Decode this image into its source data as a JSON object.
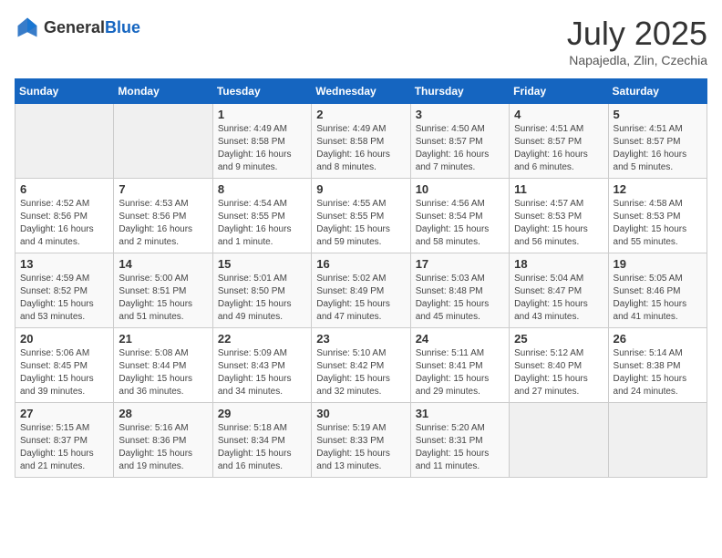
{
  "header": {
    "logo_general": "General",
    "logo_blue": "Blue",
    "month": "July 2025",
    "location": "Napajedla, Zlin, Czechia"
  },
  "days_of_week": [
    "Sunday",
    "Monday",
    "Tuesday",
    "Wednesday",
    "Thursday",
    "Friday",
    "Saturday"
  ],
  "weeks": [
    [
      {
        "day": "",
        "info": ""
      },
      {
        "day": "",
        "info": ""
      },
      {
        "day": "1",
        "info": "Sunrise: 4:49 AM\nSunset: 8:58 PM\nDaylight: 16 hours and 9 minutes."
      },
      {
        "day": "2",
        "info": "Sunrise: 4:49 AM\nSunset: 8:58 PM\nDaylight: 16 hours and 8 minutes."
      },
      {
        "day": "3",
        "info": "Sunrise: 4:50 AM\nSunset: 8:57 PM\nDaylight: 16 hours and 7 minutes."
      },
      {
        "day": "4",
        "info": "Sunrise: 4:51 AM\nSunset: 8:57 PM\nDaylight: 16 hours and 6 minutes."
      },
      {
        "day": "5",
        "info": "Sunrise: 4:51 AM\nSunset: 8:57 PM\nDaylight: 16 hours and 5 minutes."
      }
    ],
    [
      {
        "day": "6",
        "info": "Sunrise: 4:52 AM\nSunset: 8:56 PM\nDaylight: 16 hours and 4 minutes."
      },
      {
        "day": "7",
        "info": "Sunrise: 4:53 AM\nSunset: 8:56 PM\nDaylight: 16 hours and 2 minutes."
      },
      {
        "day": "8",
        "info": "Sunrise: 4:54 AM\nSunset: 8:55 PM\nDaylight: 16 hours and 1 minute."
      },
      {
        "day": "9",
        "info": "Sunrise: 4:55 AM\nSunset: 8:55 PM\nDaylight: 15 hours and 59 minutes."
      },
      {
        "day": "10",
        "info": "Sunrise: 4:56 AM\nSunset: 8:54 PM\nDaylight: 15 hours and 58 minutes."
      },
      {
        "day": "11",
        "info": "Sunrise: 4:57 AM\nSunset: 8:53 PM\nDaylight: 15 hours and 56 minutes."
      },
      {
        "day": "12",
        "info": "Sunrise: 4:58 AM\nSunset: 8:53 PM\nDaylight: 15 hours and 55 minutes."
      }
    ],
    [
      {
        "day": "13",
        "info": "Sunrise: 4:59 AM\nSunset: 8:52 PM\nDaylight: 15 hours and 53 minutes."
      },
      {
        "day": "14",
        "info": "Sunrise: 5:00 AM\nSunset: 8:51 PM\nDaylight: 15 hours and 51 minutes."
      },
      {
        "day": "15",
        "info": "Sunrise: 5:01 AM\nSunset: 8:50 PM\nDaylight: 15 hours and 49 minutes."
      },
      {
        "day": "16",
        "info": "Sunrise: 5:02 AM\nSunset: 8:49 PM\nDaylight: 15 hours and 47 minutes."
      },
      {
        "day": "17",
        "info": "Sunrise: 5:03 AM\nSunset: 8:48 PM\nDaylight: 15 hours and 45 minutes."
      },
      {
        "day": "18",
        "info": "Sunrise: 5:04 AM\nSunset: 8:47 PM\nDaylight: 15 hours and 43 minutes."
      },
      {
        "day": "19",
        "info": "Sunrise: 5:05 AM\nSunset: 8:46 PM\nDaylight: 15 hours and 41 minutes."
      }
    ],
    [
      {
        "day": "20",
        "info": "Sunrise: 5:06 AM\nSunset: 8:45 PM\nDaylight: 15 hours and 39 minutes."
      },
      {
        "day": "21",
        "info": "Sunrise: 5:08 AM\nSunset: 8:44 PM\nDaylight: 15 hours and 36 minutes."
      },
      {
        "day": "22",
        "info": "Sunrise: 5:09 AM\nSunset: 8:43 PM\nDaylight: 15 hours and 34 minutes."
      },
      {
        "day": "23",
        "info": "Sunrise: 5:10 AM\nSunset: 8:42 PM\nDaylight: 15 hours and 32 minutes."
      },
      {
        "day": "24",
        "info": "Sunrise: 5:11 AM\nSunset: 8:41 PM\nDaylight: 15 hours and 29 minutes."
      },
      {
        "day": "25",
        "info": "Sunrise: 5:12 AM\nSunset: 8:40 PM\nDaylight: 15 hours and 27 minutes."
      },
      {
        "day": "26",
        "info": "Sunrise: 5:14 AM\nSunset: 8:38 PM\nDaylight: 15 hours and 24 minutes."
      }
    ],
    [
      {
        "day": "27",
        "info": "Sunrise: 5:15 AM\nSunset: 8:37 PM\nDaylight: 15 hours and 21 minutes."
      },
      {
        "day": "28",
        "info": "Sunrise: 5:16 AM\nSunset: 8:36 PM\nDaylight: 15 hours and 19 minutes."
      },
      {
        "day": "29",
        "info": "Sunrise: 5:18 AM\nSunset: 8:34 PM\nDaylight: 15 hours and 16 minutes."
      },
      {
        "day": "30",
        "info": "Sunrise: 5:19 AM\nSunset: 8:33 PM\nDaylight: 15 hours and 13 minutes."
      },
      {
        "day": "31",
        "info": "Sunrise: 5:20 AM\nSunset: 8:31 PM\nDaylight: 15 hours and 11 minutes."
      },
      {
        "day": "",
        "info": ""
      },
      {
        "day": "",
        "info": ""
      }
    ]
  ]
}
